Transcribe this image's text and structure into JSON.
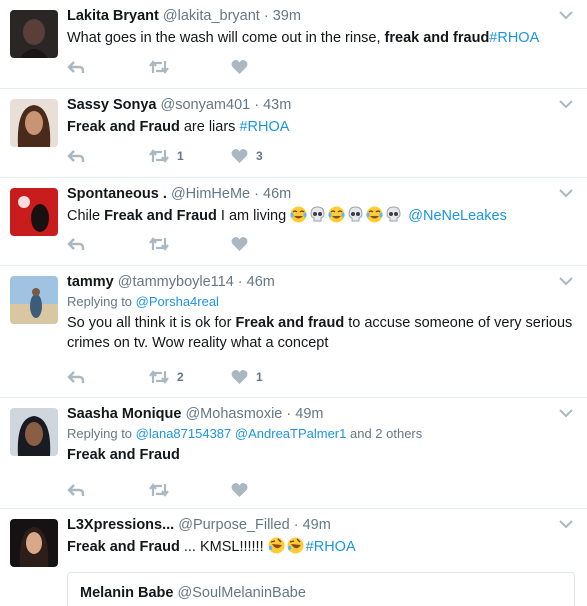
{
  "tweets": [
    {
      "name": "Lakita Bryant",
      "handle": "@lakita_bryant",
      "time": "39m",
      "text_before": "What goes in the wash will come out in the rinse, ",
      "text_bold": "freak and fraud",
      "text_hashtag": "#RHOA",
      "retweets": "",
      "likes": ""
    },
    {
      "name": "Sassy Sonya",
      "handle": "@sonyam401",
      "time": "43m",
      "text_bold": "Freak and Fraud",
      "text_after": " are liars ",
      "text_hashtag": "#RHOA",
      "retweets": "1",
      "likes": "3"
    },
    {
      "name": "Spontaneous .",
      "handle": "@HimHeMe",
      "time": "46m",
      "text_before": "Chile ",
      "text_bold": "Freak and Fraud",
      "text_after": " I am living ",
      "emojis": [
        "tears-of-joy",
        "skull",
        "tears-of-joy",
        "skull",
        "tears-of-joy",
        "skull"
      ],
      "text_mention": "@NeNeLeakes",
      "retweets": "",
      "likes": ""
    },
    {
      "name": "tammy",
      "handle": "@tammyboyle114",
      "time": "46m",
      "replying_prefix": "Replying to ",
      "replying_to": "@Porsha4real",
      "text_before": "So you all think it is ok for ",
      "text_bold": "Freak and fraud",
      "text_after": " to accuse someone of very serious crimes on tv. Wow reality what a concept",
      "retweets": "2",
      "likes": "1"
    },
    {
      "name": "Saasha Monique",
      "handle": "@Mohasmoxie",
      "time": "49m",
      "replying_prefix": "Replying to ",
      "replying_to_1": "@lana87154387",
      "replying_to_2": "@AndreaTPalmer1",
      "replying_suffix": " and 2 others",
      "text_bold": "Freak and Fraud",
      "retweets": "",
      "likes": ""
    },
    {
      "name": "L3Xpressions...",
      "handle": "@Purpose_Filled",
      "time": "49m",
      "text_bold": "Freak and Fraud",
      "text_after": " ... KMSL!!!!!! ",
      "emojis": [
        "rolling-laughing",
        "rolling-laughing"
      ],
      "text_hashtag": "#RHOA",
      "quote_name": "Melanin Babe",
      "quote_handle": "@SoulMelaninBabe"
    }
  ],
  "separator": " · ",
  "colors": {
    "link": "#1b95e0",
    "muted": "#657786",
    "icon": "#aab8c2",
    "divider": "#e6ecf0"
  },
  "icons": {
    "reply": "reply-icon",
    "retweet": "retweet-icon",
    "like": "heart-icon",
    "menu": "chevron-down-icon"
  }
}
